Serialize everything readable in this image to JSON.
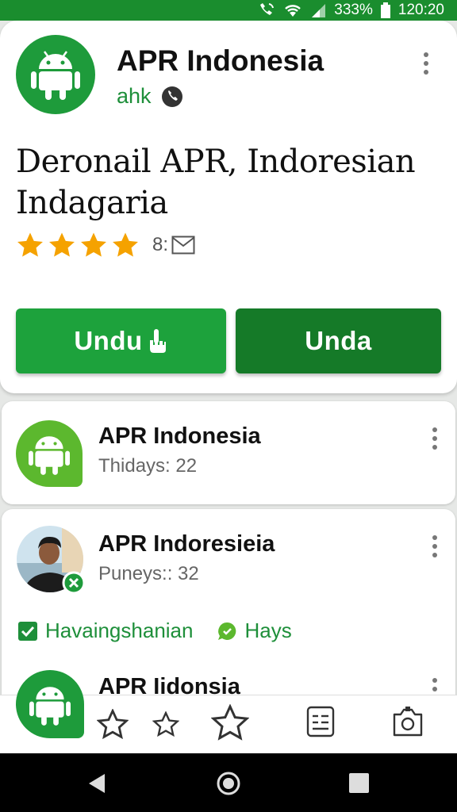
{
  "status_bar": {
    "battery_text": "333%",
    "time": "120:20"
  },
  "app_header": {
    "app_name": "APR Indonesia",
    "developer": "ahk",
    "headline": "Deronail APR, Indoresian Indagaria",
    "rating": 4,
    "rating_count": "8:",
    "buttons": {
      "install_label": "Undu",
      "open_label": "Unda"
    }
  },
  "list": [
    {
      "title": "APR Indonesia",
      "subtitle": "Thidays: 22"
    },
    {
      "title": "APR Indoresieia",
      "subtitle": "Puneys:: 32",
      "tags": [
        "Havaingshanian",
        "Hays"
      ]
    },
    {
      "title": "APR Iidonsia"
    }
  ],
  "colors": {
    "status_bar": "#1a8d2e",
    "brand_green": "#1e9b3b",
    "light_green": "#5cb82e",
    "star": "#f5a200",
    "install_button": "#1da23c",
    "open_button": "#157a28",
    "tag_green": "#1e8f3a"
  },
  "icons": {
    "status": [
      "call-wifi-icon",
      "wifi-icon",
      "signal-icon",
      "battery-icon"
    ],
    "toolbar": [
      "android-icon",
      "star-outline-icon",
      "star-outline-icon",
      "star-outline-icon",
      "list-icon",
      "camera-icon"
    ],
    "nav": [
      "back-icon",
      "home-icon",
      "recents-icon"
    ]
  }
}
